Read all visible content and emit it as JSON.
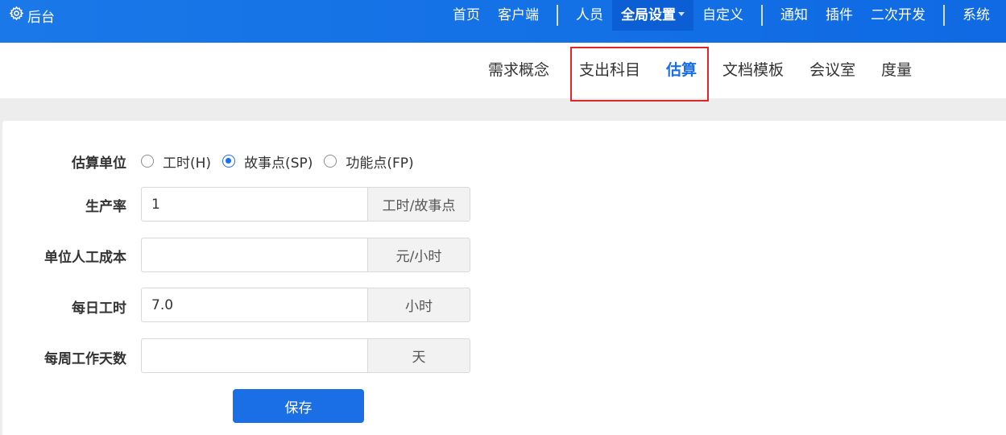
{
  "header": {
    "brand": "后台",
    "nav": [
      {
        "label": "首页"
      },
      {
        "label": "客户端"
      },
      {
        "label": "人员"
      },
      {
        "label": "全局设置"
      },
      {
        "label": "自定义"
      },
      {
        "label": "通知"
      },
      {
        "label": "插件"
      },
      {
        "label": "二次开发"
      },
      {
        "label": "系统"
      }
    ],
    "active_nav": "全局设置"
  },
  "subnav": {
    "items": [
      {
        "label": "需求概念"
      },
      {
        "label": "支出科目"
      },
      {
        "label": "估算"
      },
      {
        "label": "文档模板"
      },
      {
        "label": "会议室"
      },
      {
        "label": "度量"
      }
    ],
    "active": "估算"
  },
  "form": {
    "unit": {
      "label": "估算单位",
      "options": [
        {
          "label": "工时(H)",
          "checked": false
        },
        {
          "label": "故事点(SP)",
          "checked": true
        },
        {
          "label": "功能点(FP)",
          "checked": false
        }
      ]
    },
    "productivity": {
      "label": "生产率",
      "value": "1",
      "unit": "工时/故事点"
    },
    "unit_cost": {
      "label": "单位人工成本",
      "value": "",
      "unit": "元/小时"
    },
    "daily_hours": {
      "label": "每日工时",
      "value": "7.0",
      "unit": "小时"
    },
    "weekly_days": {
      "label": "每周工作天数",
      "value": "",
      "unit": "天"
    },
    "save_label": "保存"
  },
  "colors": {
    "header_bg": "#1a78e8",
    "accent": "#1a6fe6",
    "highlight_border": "#e0262b"
  }
}
